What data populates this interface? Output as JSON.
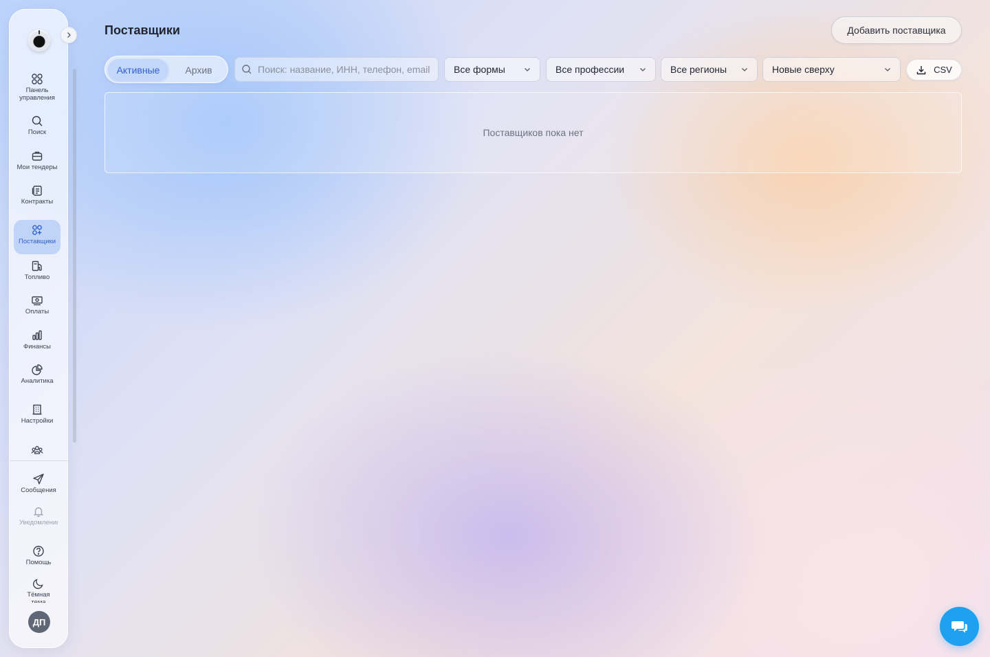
{
  "sidebar": {
    "items": [
      {
        "id": "dashboard",
        "label": "Панель управления",
        "icon": "dashboard-grid-icon"
      },
      {
        "id": "search",
        "label": "Поиск",
        "icon": "search-icon"
      },
      {
        "id": "tenders",
        "label": "Мои тендеры",
        "icon": "briefcase-icon"
      },
      {
        "id": "contracts",
        "label": "Контракты",
        "icon": "contracts-icon"
      },
      {
        "id": "suppliers",
        "label": "Поставщики",
        "icon": "suppliers-icon",
        "active": true
      },
      {
        "id": "fuel",
        "label": "Топливо",
        "icon": "fuel-icon"
      },
      {
        "id": "payments",
        "label": "Оплаты",
        "icon": "payments-icon"
      },
      {
        "id": "finance",
        "label": "Финансы",
        "icon": "bar-chart-icon"
      },
      {
        "id": "analytics",
        "label": "Аналитика",
        "icon": "pie-chart-icon"
      },
      {
        "id": "settings",
        "label": "Настройки",
        "icon": "building-icon"
      },
      {
        "id": "team",
        "label": "",
        "icon": "team-icon"
      }
    ],
    "bottom": [
      {
        "id": "messages",
        "label": "Сообщения",
        "icon": "send-icon"
      },
      {
        "id": "notifications",
        "label": "Уведомления",
        "icon": "bell-icon"
      },
      {
        "id": "help",
        "label": "Помощь",
        "icon": "help-icon"
      },
      {
        "id": "theme",
        "label": "Тёмная тема",
        "icon": "moon-icon"
      }
    ],
    "avatar_initials": "ДП"
  },
  "header": {
    "title": "Поставщики",
    "add_button": "Добавить поставщика"
  },
  "toolbar": {
    "tabs": [
      {
        "label": "Активные",
        "selected": true
      },
      {
        "label": "Архив",
        "selected": false
      }
    ],
    "search_placeholder": "Поиск: название, ИНН, телефон, email",
    "filters": {
      "form": "Все формы",
      "profession": "Все профессии",
      "region": "Все регионы",
      "sort": "Новые сверху"
    },
    "csv_label": "CSV"
  },
  "empty_state": "Поставщиков пока нет",
  "colors": {
    "accent": "#2f5fd0",
    "chat_button": "#1ea2f0",
    "active_nav": "#adc7f5"
  }
}
